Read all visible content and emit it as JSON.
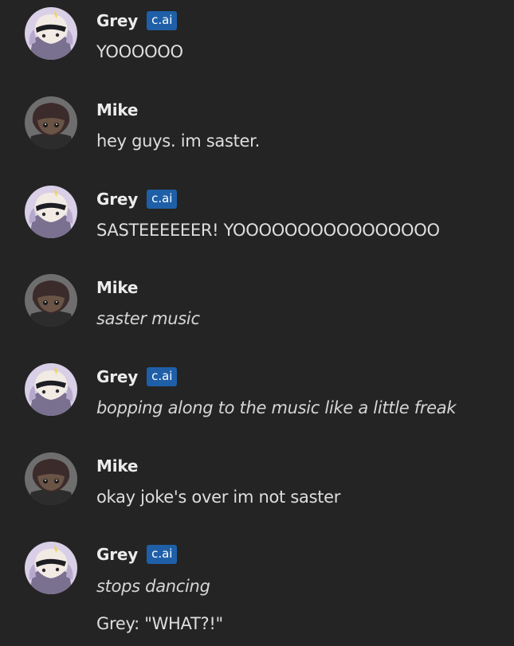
{
  "badge_label": "c.ai",
  "colors": {
    "background": "#242424",
    "badge": "#1f5fa8",
    "name": "#ececec",
    "text": "#dedede"
  },
  "messages": [
    {
      "author": "Grey",
      "avatar": "grey-avatar-icon",
      "badge": true,
      "lines": [
        {
          "text": "YOOOOOO",
          "italic": false
        }
      ]
    },
    {
      "author": "Mike",
      "avatar": "mike-avatar-icon",
      "badge": false,
      "lines": [
        {
          "text": "hey guys. im saster.",
          "italic": false
        }
      ]
    },
    {
      "author": "Grey",
      "avatar": "grey-avatar-icon",
      "badge": true,
      "lines": [
        {
          "text": "SASTEEEEEER! YOOOOOOOOOOOOOOOO",
          "italic": false
        }
      ]
    },
    {
      "author": "Mike",
      "avatar": "mike-avatar-icon",
      "badge": false,
      "lines": [
        {
          "text": "saster music",
          "italic": true
        }
      ]
    },
    {
      "author": "Grey",
      "avatar": "grey-avatar-icon",
      "badge": true,
      "lines": [
        {
          "text": "bopping along to the music like a little freak",
          "italic": true
        }
      ]
    },
    {
      "author": "Mike",
      "avatar": "mike-avatar-icon",
      "badge": false,
      "lines": [
        {
          "text": "okay joke's over im not saster",
          "italic": false
        }
      ]
    },
    {
      "author": "Grey",
      "avatar": "grey-avatar-icon",
      "badge": true,
      "lines": [
        {
          "text": "stops dancing",
          "italic": true
        },
        {
          "text": "Grey: \"WHAT?!\"",
          "italic": false
        }
      ]
    }
  ]
}
